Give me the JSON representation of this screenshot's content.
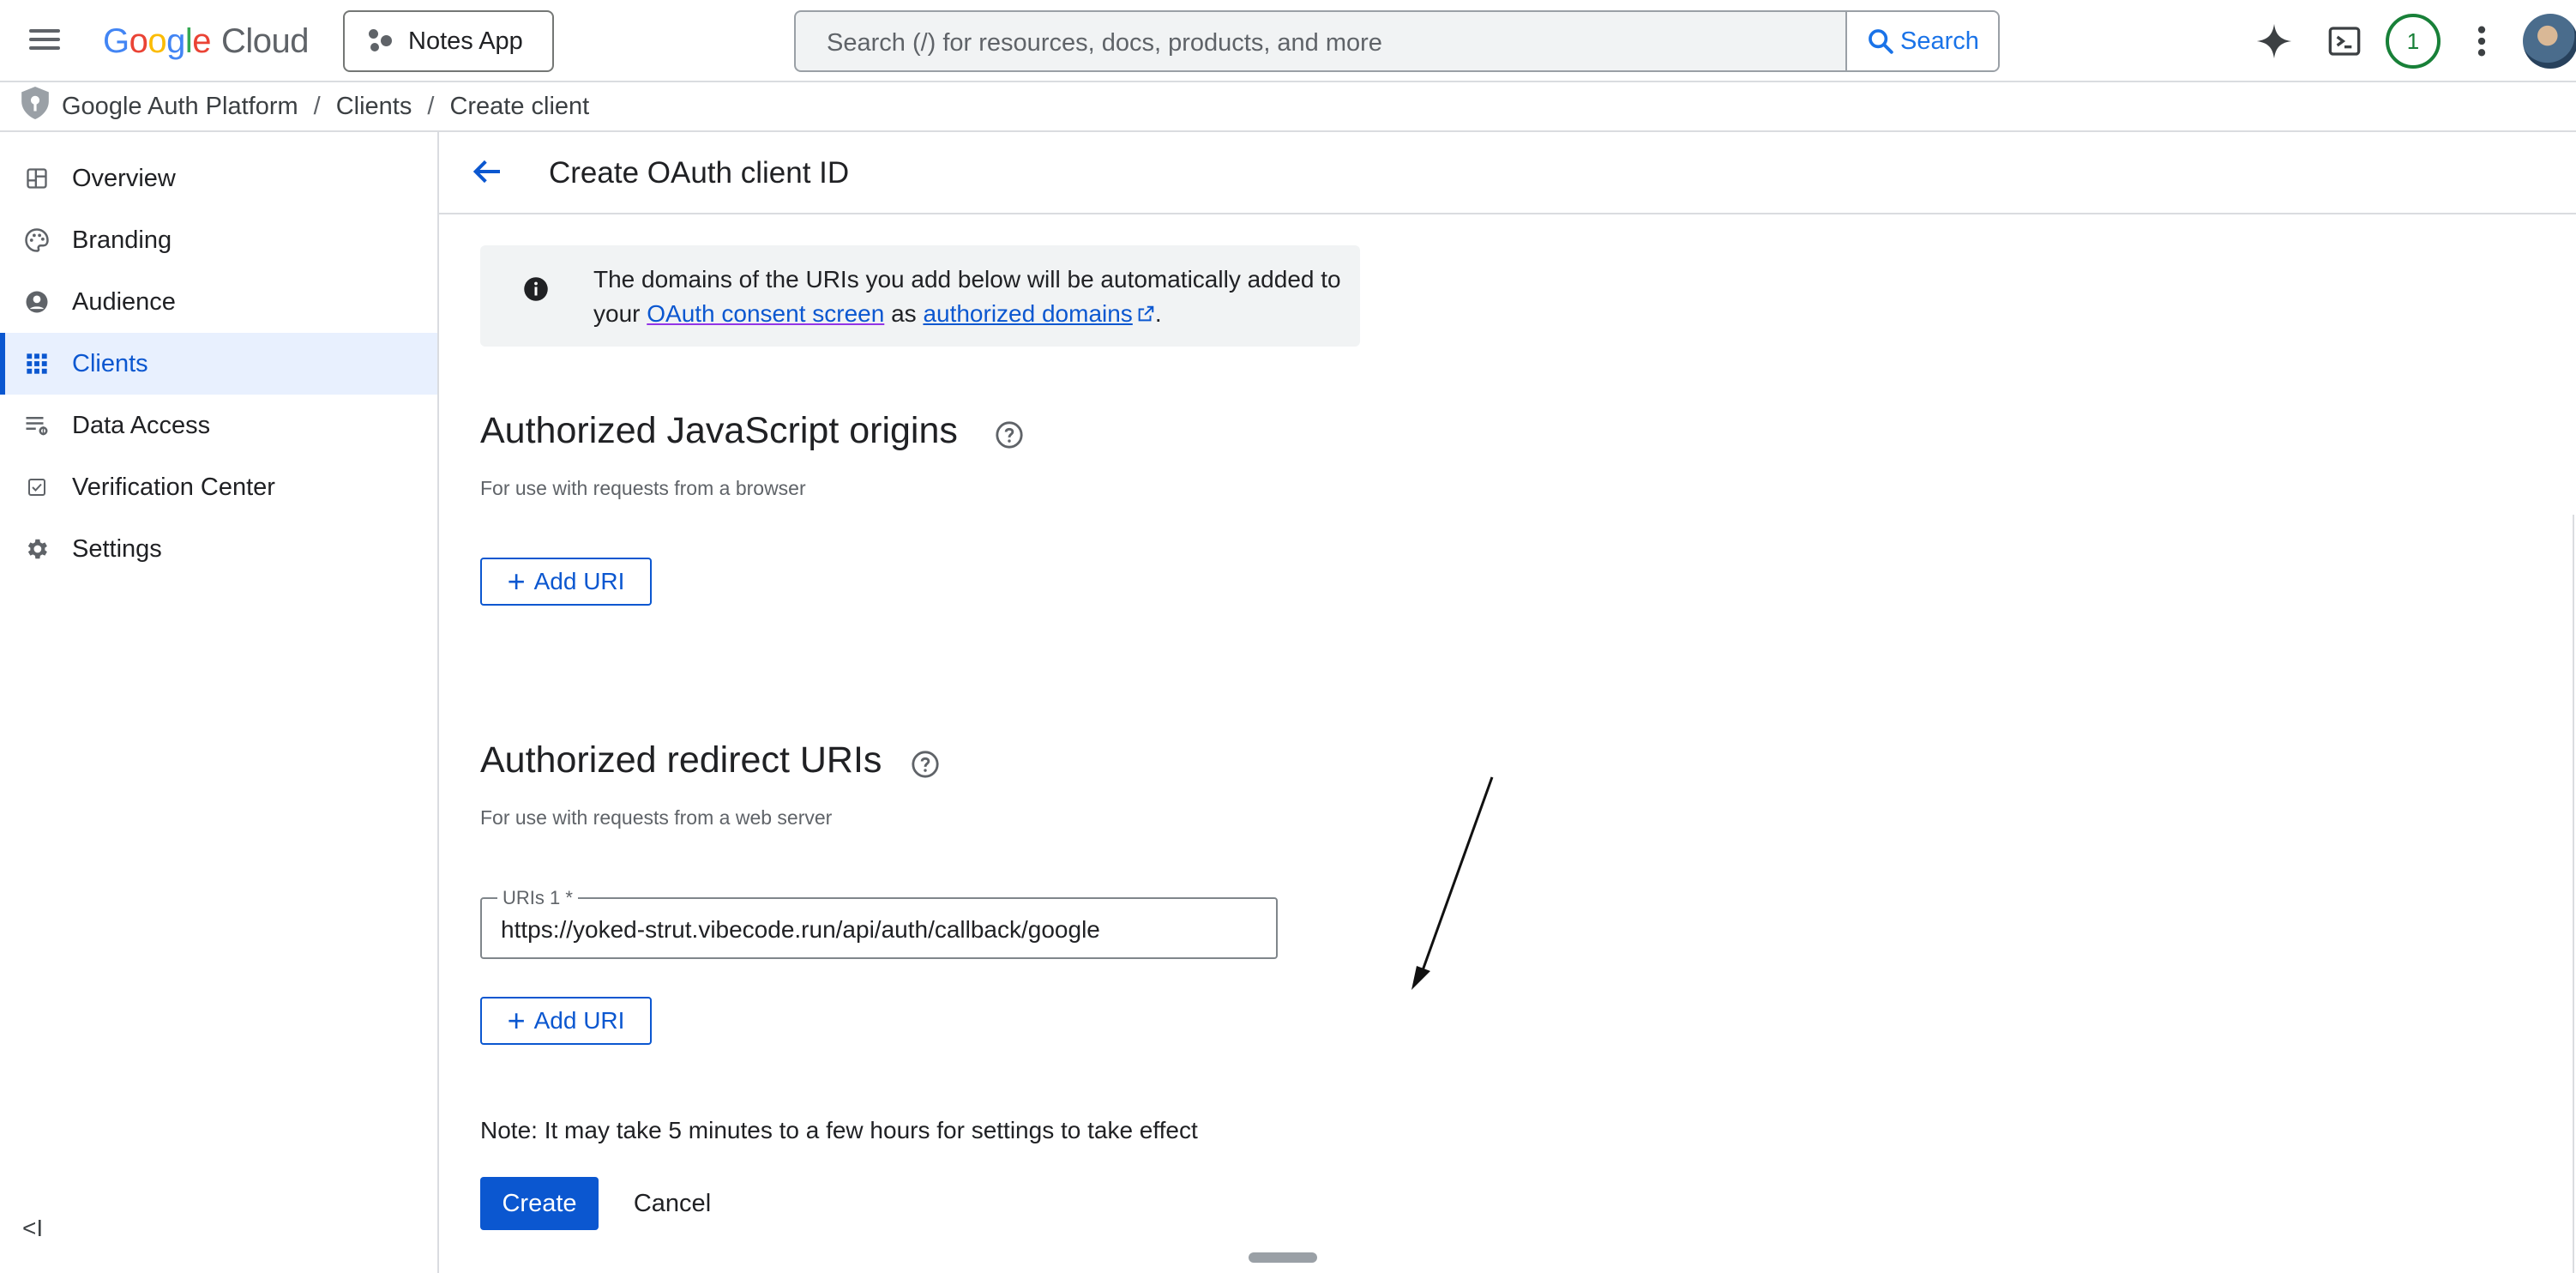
{
  "topbar": {
    "logo_letters": [
      "G",
      "o",
      "o",
      "g",
      "l",
      "e"
    ],
    "logo_product": "Cloud",
    "project_name": "Notes App",
    "search_placeholder": "Search (/) for resources, docs, products, and more",
    "search_button": "Search",
    "notification_count": "1"
  },
  "breadcrumb": [
    "Google Auth Platform",
    "Clients",
    "Create client"
  ],
  "sidebar": {
    "items": [
      {
        "label": "Overview",
        "icon": "dashboard-icon"
      },
      {
        "label": "Branding",
        "icon": "palette-icon"
      },
      {
        "label": "Audience",
        "icon": "account-circle-icon"
      },
      {
        "label": "Clients",
        "icon": "grid-icon",
        "active": true
      },
      {
        "label": "Data Access",
        "icon": "data-access-icon"
      },
      {
        "label": "Verification Center",
        "icon": "checkbox-icon"
      },
      {
        "label": "Settings",
        "icon": "gear-icon"
      }
    ],
    "collapse_label": "<I"
  },
  "main": {
    "title": "Create OAuth client ID",
    "info": {
      "text_before": "The domains of the URIs you add below will be automatically added to your ",
      "link1": "OAuth consent screen",
      "text_mid": " as ",
      "link2": "authorized domains",
      "text_after": "."
    },
    "js_origins": {
      "title": "Authorized JavaScript origins",
      "subtitle": "For use with requests from a browser",
      "add_label": "Add URI"
    },
    "redirect_uris": {
      "title": "Authorized redirect URIs",
      "subtitle": "For use with requests from a web server",
      "field_label": "URIs 1 *",
      "field_value": "https://yoked-strut.vibecode.run/api/auth/callback/google",
      "add_label": "Add URI"
    },
    "note": "Note: It may take 5 minutes to a few hours for settings to take effect",
    "create_label": "Create",
    "cancel_label": "Cancel"
  },
  "colors": {
    "accent": "#0b57d0",
    "active_bg": "#e8f0fe",
    "border": "#dadce0",
    "success": "#188038"
  }
}
